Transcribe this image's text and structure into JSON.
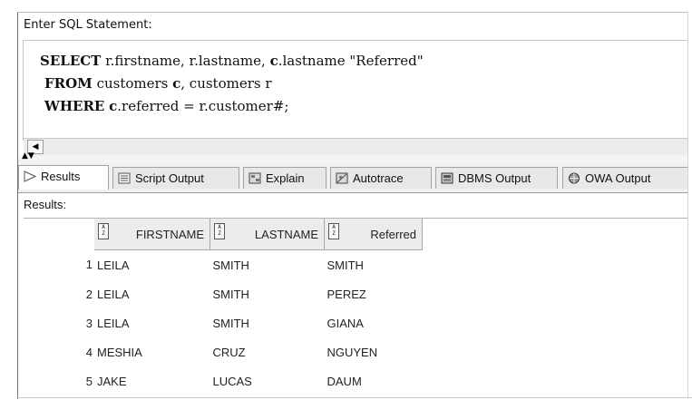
{
  "editor": {
    "label": "Enter SQL Statement:",
    "lines": [
      {
        "kw": "SELECT",
        "rest": " r.firstname, r.lastname, ",
        "kw2": "c",
        "rest2": ".lastname \"Referred\""
      },
      {
        "kw": "FROM",
        "rest": " customers ",
        "kw2": "c",
        "rest2": ", customers r"
      },
      {
        "kw": "WHERE",
        "rest": " ",
        "kw2": "c",
        "rest2": ".referred = r.customer#;"
      }
    ]
  },
  "tabs": [
    {
      "label": "Results",
      "icon": "play-triangle-icon",
      "active": true
    },
    {
      "label": "Script Output",
      "icon": "script-icon",
      "active": false
    },
    {
      "label": "Explain",
      "icon": "explain-icon",
      "active": false
    },
    {
      "label": "Autotrace",
      "icon": "autotrace-icon",
      "active": false
    },
    {
      "label": "DBMS Output",
      "icon": "dbms-icon",
      "active": false
    },
    {
      "label": "OWA Output",
      "icon": "owa-globe-icon",
      "active": false
    }
  ],
  "results": {
    "label": "Results:",
    "columns": [
      "FIRSTNAME",
      "LASTNAME",
      "Referred"
    ],
    "rows": [
      {
        "n": "1",
        "cells": [
          "LEILA",
          "SMITH",
          "SMITH"
        ]
      },
      {
        "n": "2",
        "cells": [
          "LEILA",
          "SMITH",
          "PEREZ"
        ]
      },
      {
        "n": "3",
        "cells": [
          "LEILA",
          "SMITH",
          "GIANA"
        ]
      },
      {
        "n": "4",
        "cells": [
          "MESHIA",
          "CRUZ",
          "NGUYEN"
        ]
      },
      {
        "n": "5",
        "cells": [
          "JAKE",
          "LUCAS",
          "DAUM"
        ]
      }
    ]
  },
  "sort_icon_glyph": "A\nZ",
  "colors": {
    "tab_active": "#ffffff",
    "tab_inactive": "#e8e8e8",
    "header_bg": "#ececec"
  }
}
